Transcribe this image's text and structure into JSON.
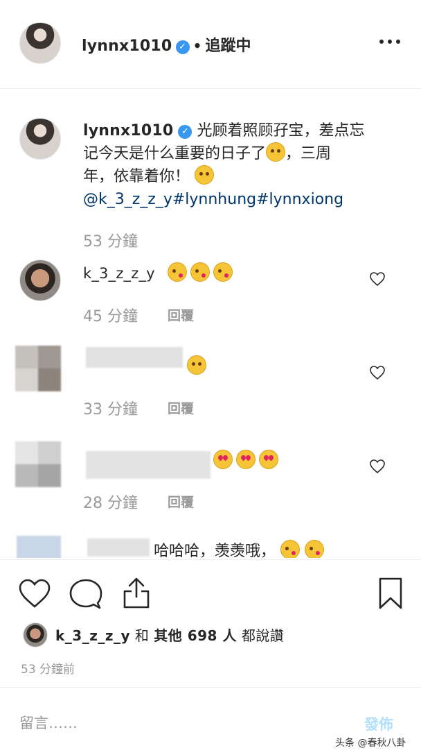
{
  "header": {
    "username": "lynnx1010",
    "verified_mark": "✓",
    "dot": "•",
    "follow_status": "追蹤中",
    "more_icon": "more-icon"
  },
  "caption": {
    "username": "lynnx1010",
    "line1": "光顾着照顾孖宝，差点忘",
    "line2a": "记今天是什么重要的日子了",
    "line2b": "，三周",
    "line3": "年，依靠着你！",
    "tags": "@k_3_z_z_y#lynnhung#lynnxiong",
    "time": "53 分鐘"
  },
  "comments": [
    {
      "username": "k_3_z_z_y",
      "time": "45 分鐘",
      "reply": "回覆"
    },
    {
      "time": "33 分鐘",
      "reply": "回覆"
    },
    {
      "time": "28 分鐘",
      "reply": "回覆"
    },
    {
      "text": "哈哈哈，羡羡哦，"
    }
  ],
  "likes": {
    "user": "k_3_z_z_y",
    "and": "和",
    "others": "其他 698 人",
    "suffix": "都說讚"
  },
  "post_time": "53 分鐘前",
  "comment_box": {
    "placeholder": "留言……",
    "post_label": "發佈"
  },
  "watermark": "头条 @春秋八卦"
}
